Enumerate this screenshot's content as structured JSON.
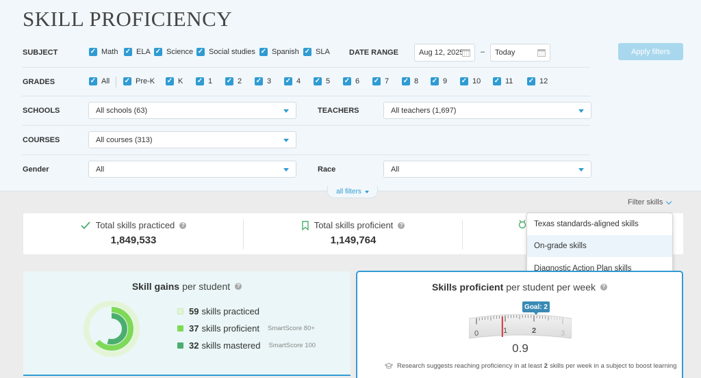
{
  "page": {
    "title": "SKILL PROFICIENCY"
  },
  "filters": {
    "subject": {
      "label": "SUBJECT",
      "options": [
        {
          "label": "Math",
          "checked": true
        },
        {
          "label": "ELA",
          "checked": true
        },
        {
          "label": "Science",
          "checked": true
        },
        {
          "label": "Social studies",
          "checked": true
        },
        {
          "label": "Spanish",
          "checked": true
        },
        {
          "label": "SLA",
          "checked": true
        }
      ]
    },
    "date_range": {
      "label": "DATE RANGE",
      "start": "Aug 12, 2025",
      "separator": "–",
      "end": "Today"
    },
    "grades": {
      "label": "GRADES",
      "all": {
        "label": "All",
        "checked": true
      },
      "options": [
        {
          "label": "Pre-K",
          "checked": true
        },
        {
          "label": "K",
          "checked": true
        },
        {
          "label": "1",
          "checked": true
        },
        {
          "label": "2",
          "checked": true
        },
        {
          "label": "3",
          "checked": true
        },
        {
          "label": "4",
          "checked": true
        },
        {
          "label": "5",
          "checked": true
        },
        {
          "label": "6",
          "checked": true
        },
        {
          "label": "7",
          "checked": true
        },
        {
          "label": "8",
          "checked": true
        },
        {
          "label": "9",
          "checked": true
        },
        {
          "label": "10",
          "checked": true
        },
        {
          "label": "11",
          "checked": true
        },
        {
          "label": "12",
          "checked": true
        }
      ]
    },
    "schools": {
      "label": "SCHOOLS",
      "value": "All schools (63)"
    },
    "teachers": {
      "label": "TEACHERS",
      "value": "All teachers (1,697)"
    },
    "courses": {
      "label": "COURSES",
      "value": "All courses (313)"
    },
    "gender": {
      "label": "Gender",
      "value": "All"
    },
    "race": {
      "label": "Race",
      "value": "All"
    },
    "apply_label": "Apply filters",
    "all_filters_label": "all filters"
  },
  "filter_skills": {
    "label": "Filter skills",
    "items": [
      {
        "label": "Texas standards-aligned skills",
        "highlighted": false
      },
      {
        "label": "On-grade skills",
        "highlighted": true
      },
      {
        "label": "Diagnostic Action Plan skills",
        "highlighted": false
      }
    ]
  },
  "stats": {
    "practiced": {
      "label": "Total skills practiced",
      "value": "1,849,533"
    },
    "proficient": {
      "label": "Total skills proficient",
      "value": "1,149,764"
    }
  },
  "skill_gains": {
    "title_bold": "Skill gains",
    "title_rest": "per student",
    "practiced": {
      "value": "59",
      "label": "skills practiced",
      "color": "#e3f5d6"
    },
    "proficient": {
      "value": "37",
      "label": "skills proficient",
      "note": "SmartScore 80+",
      "color": "#7ed957"
    },
    "mastered": {
      "value": "32",
      "label": "skills mastered",
      "note": "SmartScore 100",
      "color": "#4cae6e"
    }
  },
  "proficient_per_week": {
    "title_bold": "Skills proficient",
    "title_rest": "per student per week",
    "goal_label": "Goal: 2",
    "value": "0.9",
    "gauge_value": 0.9,
    "goal": 2,
    "gauge_ticks": [
      "0",
      "1",
      "2",
      "3"
    ],
    "research_pre": "Research suggests reaching proficiency in at least",
    "research_num": "2",
    "research_post": "skills per week in a subject to boost learning"
  },
  "colors": {
    "accent": "#2f9bd3",
    "apply_disabled": "#a9d8ee",
    "goal_badge": "#3a8ab5",
    "gauge_needle": "#d9343a"
  }
}
